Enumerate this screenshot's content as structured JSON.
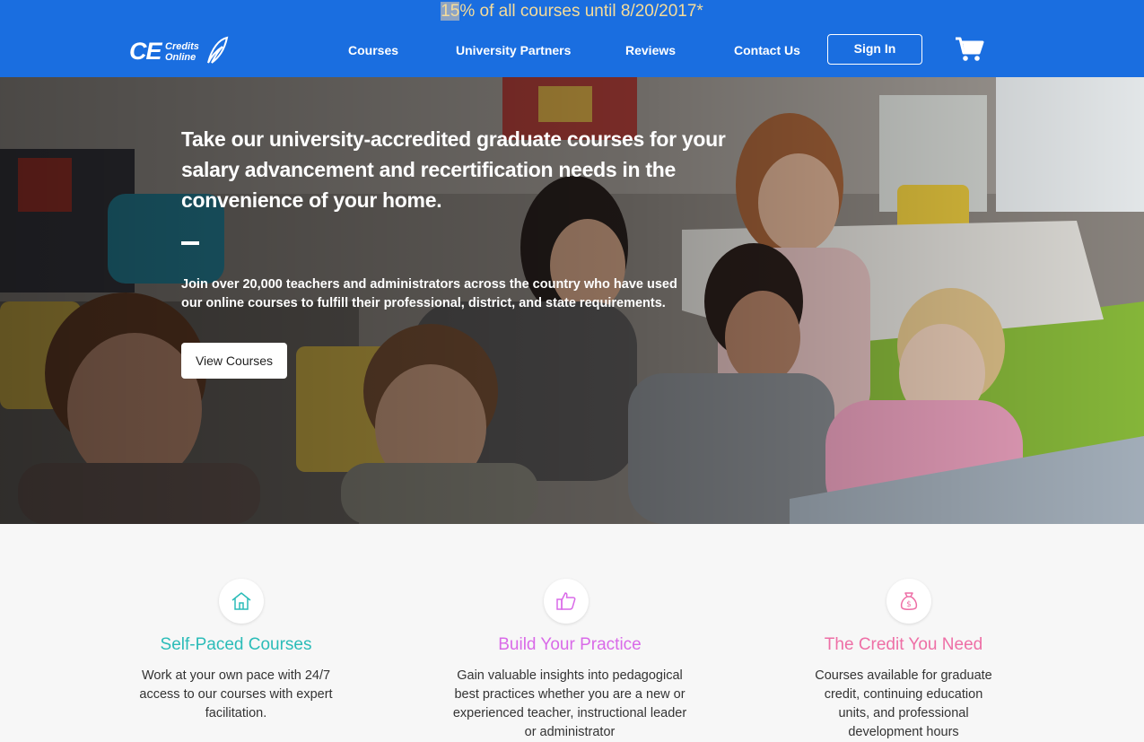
{
  "promo": {
    "highlight": "15",
    "text": "% of all courses until 8/20/2017*",
    "text_color": "#f5dc9a"
  },
  "brand": {
    "logo_main": "CE",
    "logo_line1": "Credits",
    "logo_line2": "Online",
    "header_color": "#1a6ee0"
  },
  "nav": {
    "items": [
      "Courses",
      "University Partners",
      "Reviews",
      "Contact Us"
    ],
    "sign_in": "Sign In",
    "cart_icon": "shopping-cart-icon"
  },
  "hero": {
    "title": "Take our university-accredited graduate courses for your salary advancement and recertification needs in the convenience of your home.",
    "subtitle": "Join over 20,000 teachers and administrators across the country who have used our online courses to fulfill their professional, district, and state requirements.",
    "button": "View Courses"
  },
  "features": [
    {
      "icon": "house-icon",
      "title": "Self-Paced Courses",
      "color": "#2bbcb8",
      "text": "Work at your own pace with 24/7 access to our courses with expert facilitation."
    },
    {
      "icon": "thumbs-up-icon",
      "title": "Build Your Practice",
      "color": "#d96ae8",
      "text": "Gain valuable insights into pedagogical best practices whether you are a new or experienced teacher, instructional leader or administrator"
    },
    {
      "icon": "money-bag-icon",
      "title": "The Credit You Need",
      "color": "#ee6fa6",
      "text": "Courses available for graduate credit, continuing education units, and professional development hours"
    }
  ]
}
